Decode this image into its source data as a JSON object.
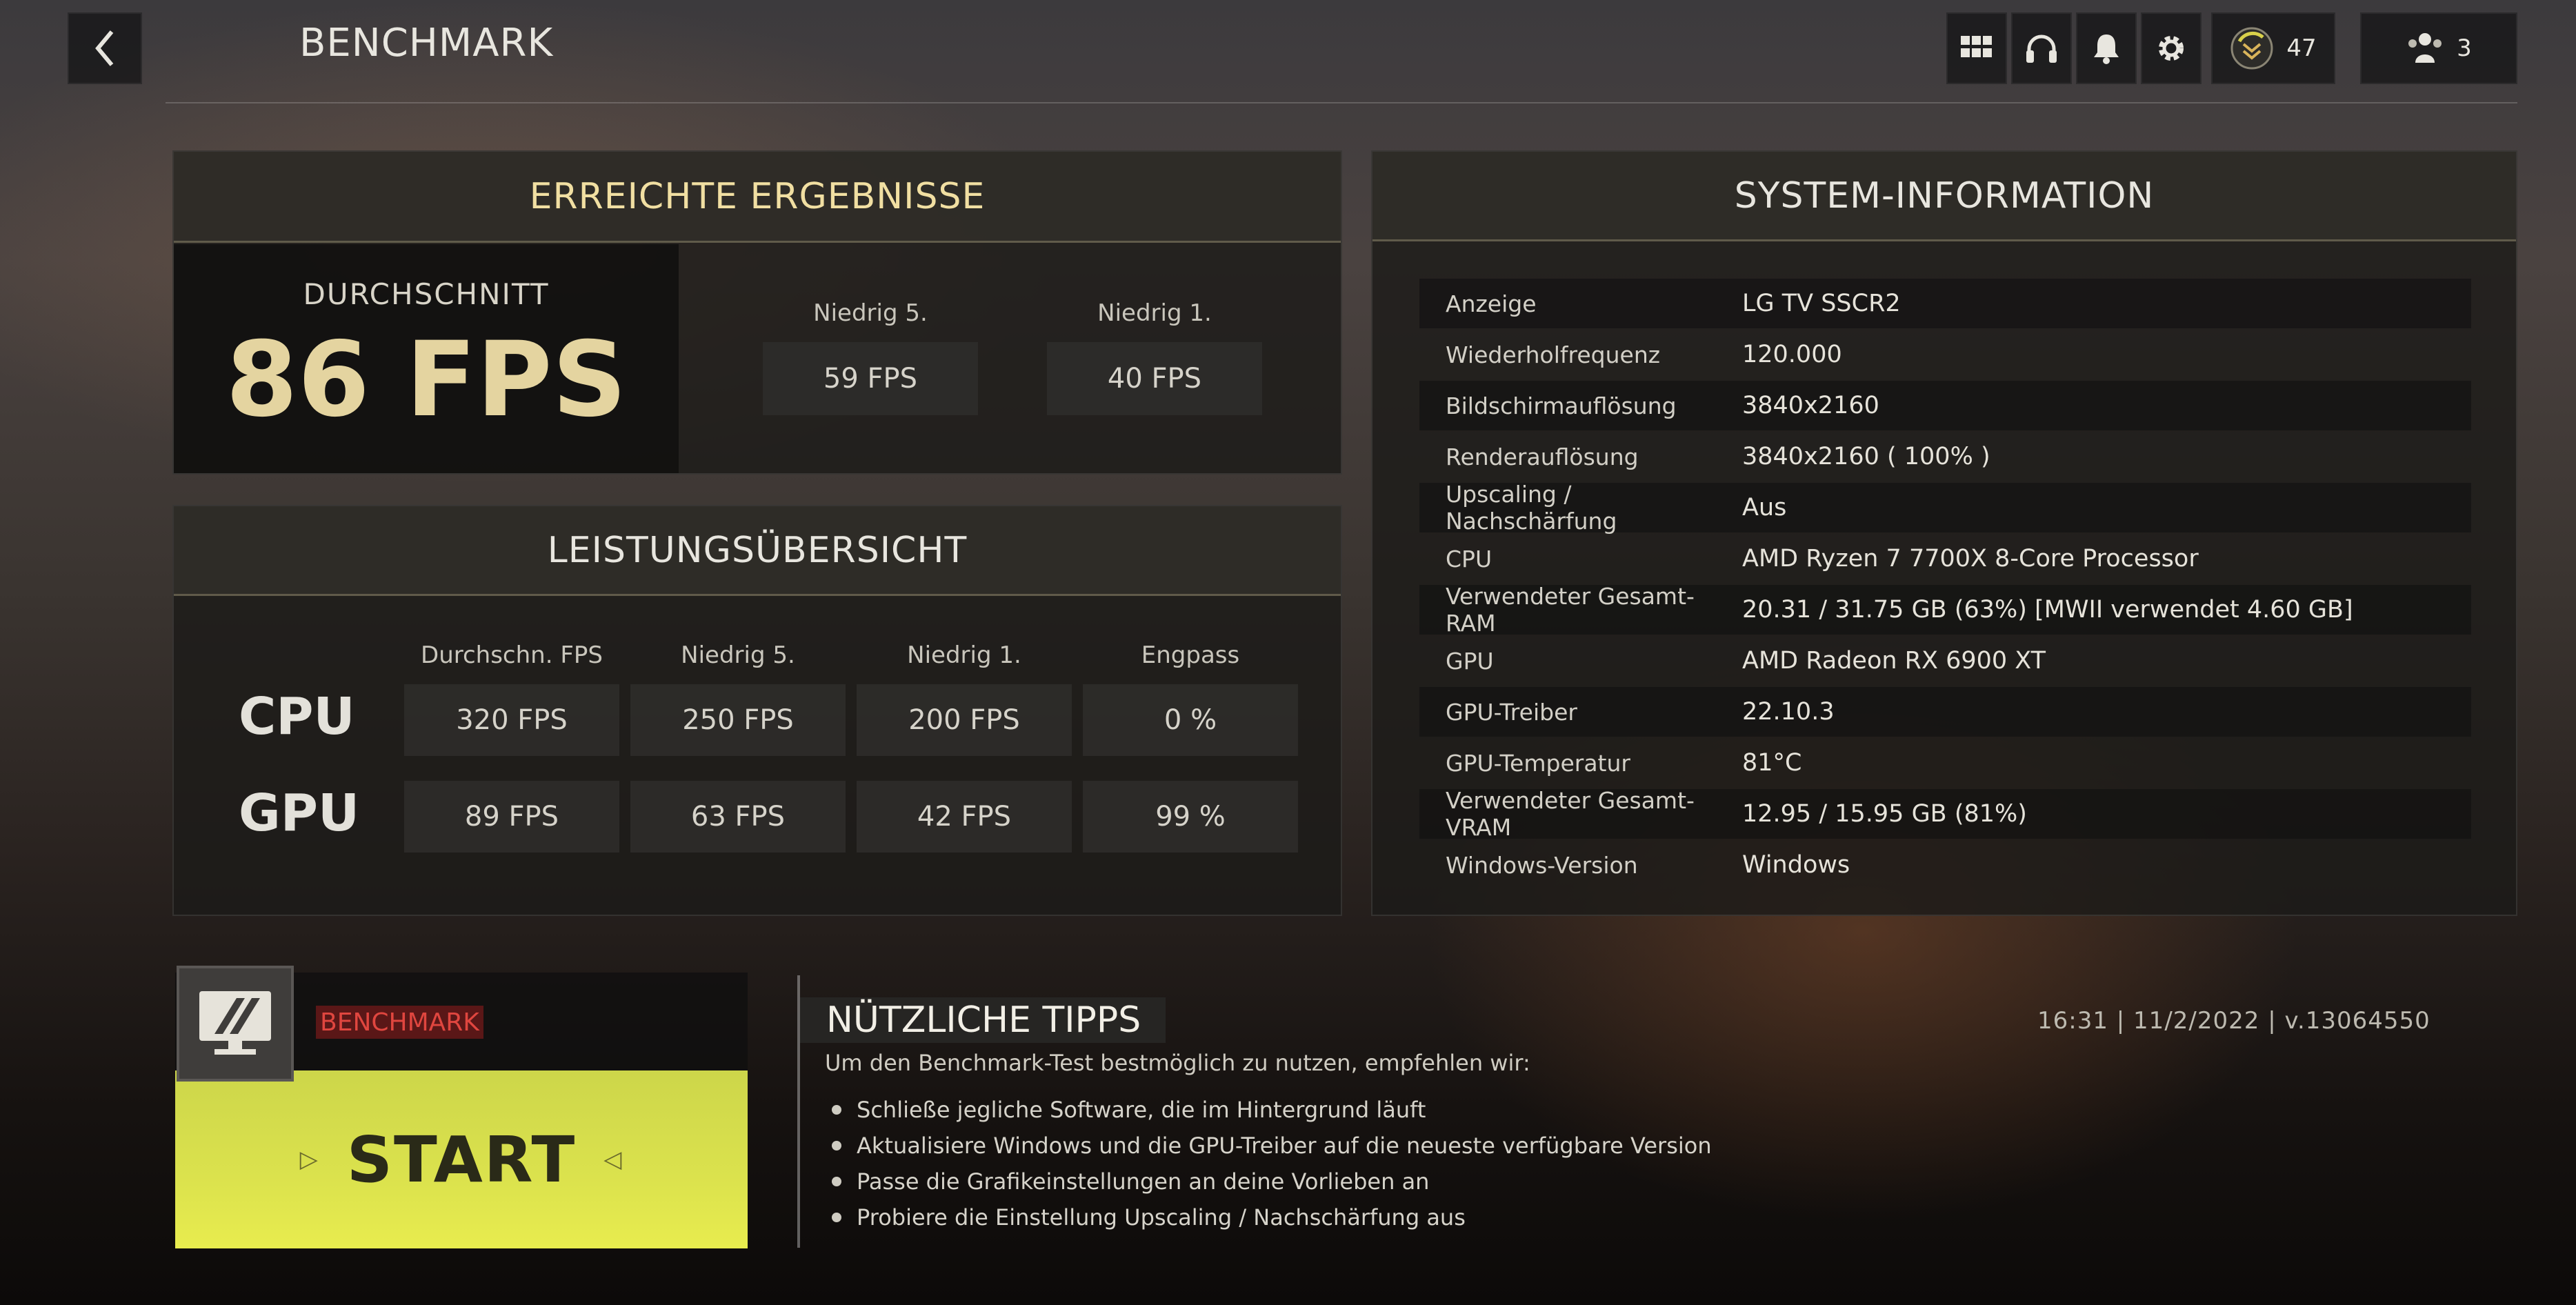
{
  "header": {
    "title": "BENCHMARK",
    "level": "47",
    "party_count": "3"
  },
  "results": {
    "title": "ERREICHTE ERGEBNISSE",
    "average_label": "DURCHSCHNITT",
    "average_value": "86 FPS",
    "low5_label": "Niedrig 5.",
    "low5_value": "59 FPS",
    "low1_label": "Niedrig 1.",
    "low1_value": "40 FPS"
  },
  "performance": {
    "title": "LEISTUNGSÜBERSICHT",
    "columns": [
      "Durchschn. FPS",
      "Niedrig 5.",
      "Niedrig 1.",
      "Engpass"
    ],
    "rows": [
      {
        "label": "CPU",
        "values": [
          "320 FPS",
          "250 FPS",
          "200 FPS",
          "0 %"
        ]
      },
      {
        "label": "GPU",
        "values": [
          "89 FPS",
          "63 FPS",
          "42 FPS",
          "99 %"
        ]
      }
    ]
  },
  "system": {
    "title": "SYSTEM-INFORMATION",
    "rows": [
      {
        "label": "Anzeige",
        "value": "LG TV SSCR2"
      },
      {
        "label": "Wiederholfrequenz",
        "value": "120.000"
      },
      {
        "label": "Bildschirmauflösung",
        "value": "3840x2160"
      },
      {
        "label": "Renderauflösung",
        "value": "3840x2160 ( 100% )"
      },
      {
        "label": "Upscaling / Nachschärfung",
        "value": "Aus"
      },
      {
        "label": "CPU",
        "value": "AMD Ryzen 7 7700X 8-Core Processor"
      },
      {
        "label": "Verwendeter Gesamt-RAM",
        "value": "20.31 / 31.75 GB (63%) [MWII verwendet 4.60 GB]"
      },
      {
        "label": "GPU",
        "value": "AMD Radeon RX 6900 XT"
      },
      {
        "label": "GPU-Treiber",
        "value": "22.10.3"
      },
      {
        "label": "GPU-Temperatur",
        "value": "81°C"
      },
      {
        "label": "Verwendeter Gesamt-VRAM",
        "value": "12.95 / 15.95 GB (81%)"
      },
      {
        "label": "Windows-Version",
        "value": "Windows"
      }
    ]
  },
  "benchmark": {
    "tag": "BENCHMARK",
    "start_label": "START"
  },
  "tips": {
    "title": "NÜTZLICHE TIPPS",
    "intro": "Um den Benchmark-Test bestmöglich zu nutzen, empfehlen wir:",
    "items": [
      "Schließe jegliche Software, die im Hintergrund läuft",
      "Aktualisiere Windows und die GPU-Treiber auf die neueste verfügbare Version",
      "Passe die Grafikeinstellungen an deine Vorlieben an",
      "Probiere die Einstellung Upscaling / Nachschärfung aus"
    ]
  },
  "build_info": "16:31 | 11/2/2022 | v.13064550",
  "colors": {
    "accent_gold": "#e4d4a0",
    "start_yellow": "#dbe24d",
    "benchmark_red": "#e0463f"
  },
  "icons": [
    "back-chevron-icon",
    "grid-menu-icon",
    "headset-icon",
    "bell-icon",
    "gear-icon",
    "rank-badge-icon",
    "party-icon",
    "monitor-icon"
  ]
}
